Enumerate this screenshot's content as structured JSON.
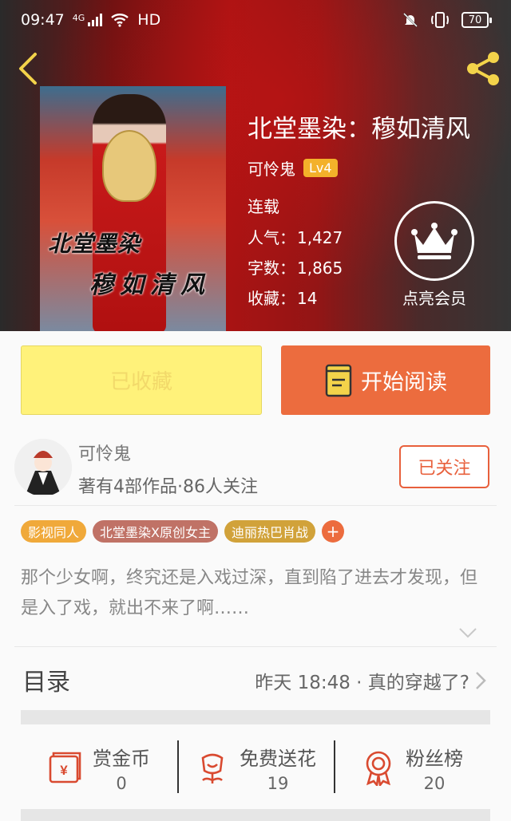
{
  "status_bar": {
    "time": "09:47",
    "network": "4G",
    "hd": "HD",
    "battery": "70"
  },
  "book": {
    "title": "北堂墨染：穆如清风",
    "cover_text_line1": "北堂墨染",
    "cover_text_line2": "穆如清风",
    "author": "可怜鬼",
    "author_level": "Lv4",
    "status": "连载",
    "popularity_label": "人气：",
    "popularity": "1,427",
    "word_count_label": "字数：",
    "word_count": "1,865",
    "favorites_label": "收藏：",
    "favorites": "14"
  },
  "vip": {
    "label": "点亮会员"
  },
  "actions": {
    "collected_label": "已收藏",
    "read_label": "开始阅读"
  },
  "writer": {
    "name": "可怜鬼",
    "stats": "著有4部作品·86人关注",
    "follow_label": "已关注"
  },
  "tags": [
    {
      "label": "影视同人",
      "color": "#f0a93a"
    },
    {
      "label": "北堂墨染X原创女主",
      "color": "#c07266"
    },
    {
      "label": "迪丽热巴肖战",
      "color": "#d1a23a"
    }
  ],
  "tag_add": "+",
  "intro": "那个少女啊，终究还是入戏过深，直到陷了进去才发现，但是入了戏，就出不来了啊……",
  "toc": {
    "title": "目录",
    "latest": "昨天 18:48 · 真的穿越了?"
  },
  "rewards": [
    {
      "label": "赏金币",
      "value": "0"
    },
    {
      "label": "免费送花",
      "value": "19"
    },
    {
      "label": "粉丝榜",
      "value": "20"
    }
  ],
  "colors": {
    "accent": "#ec6c3e",
    "collected_bg": "#fff27a",
    "level_badge": "#f3b12a",
    "icon_yellow": "#f3d34a"
  }
}
